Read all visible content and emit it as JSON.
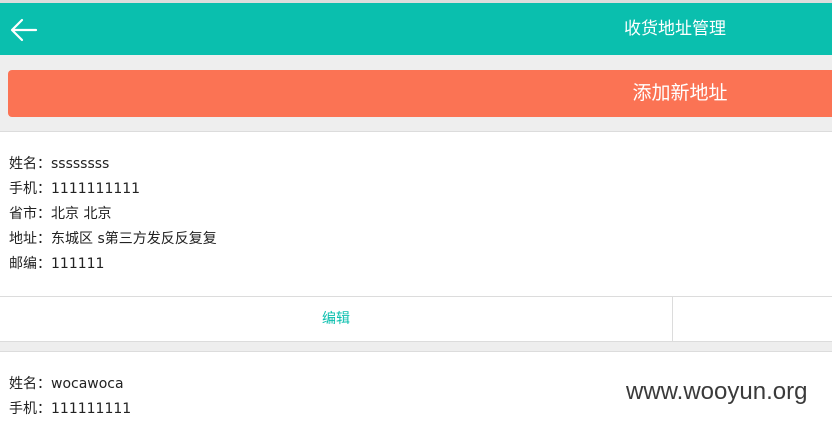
{
  "header": {
    "title": "收货地址管理",
    "back_icon": "arrow-left-icon",
    "background": "#0abfae"
  },
  "add_button": {
    "label": "添加新地址",
    "background": "#fb7354"
  },
  "addresses": [
    {
      "name": "姓名：ssssssss",
      "phone": "手机：1111111111",
      "province_city": "省市：北京 北京",
      "address": "地址：东城区 s第三方发反反复复",
      "postcode": "邮编：111111",
      "edit_label": "编辑"
    },
    {
      "name": "姓名：wocawoca",
      "phone": "手机：111111111"
    }
  ],
  "watermark": "www.wooyun.org"
}
